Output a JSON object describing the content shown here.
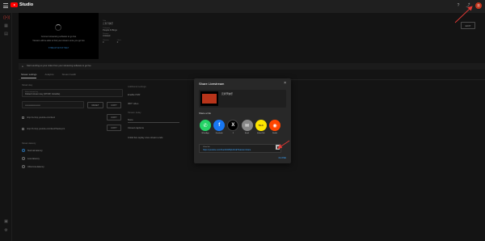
{
  "app": {
    "logo_text": "Studio",
    "avatar_letter": "亦"
  },
  "colors": {
    "accent": "#3ea6ff",
    "brand_red": "#ff0000",
    "annotation": "#e53935",
    "background": "#1f1f1f",
    "dialog_bg": "#282828"
  },
  "preview": {
    "line1": "Connect streaming software to go live",
    "line2": "Viewers will be able to find your stream once you go live",
    "link": "STREAM SETUP HELP"
  },
  "meta": {
    "title_label": "Title",
    "title_value": "元宵节快乐",
    "category_label": "Category",
    "category_value": "People & Blogs",
    "privacy_label": "Privacy",
    "privacy_value": "Unlisted",
    "viewers_label": "Viewers",
    "viewers_value": "0",
    "likes_label": "Likes",
    "likes_value": "0"
  },
  "edit_button": "EDIT",
  "hint": {
    "text": "Start sending us your video from your streaming software to go live"
  },
  "tabs": [
    "Stream settings",
    "Analytics",
    "Stream health"
  ],
  "left": {
    "stream_key_label": "Stream key",
    "select_key_label": "Select stream key",
    "select_key_value": "Default stream key (RTMP, Variable)",
    "stream_key_value": "••••••••••••••••••••",
    "reset": "RESET",
    "copy": "COPY",
    "url1": "rtmp://a.rtmp.youtube.com/live2",
    "url2": "rtmp://b.rtmp.youtube.com/live2?backup=1",
    "latency_label": "Stream latency",
    "latency_options": [
      "Normal latency",
      "Low-latency",
      "Ultra low-latency"
    ]
  },
  "right": {
    "additional": "Additional settings",
    "dvr": "Enable DVR",
    "video360": "360° video",
    "delay": "Stream delay",
    "delay_value": "None",
    "captions": "Closed captions",
    "unlist": "Unlist live replay once stream ends"
  },
  "dialog": {
    "title": "Share Livestream",
    "card_title": "元宵节快乐",
    "share_label": "Share a link",
    "platforms": [
      {
        "name": "WhatsApp",
        "glyph": "✆",
        "color": "#25d366"
      },
      {
        "name": "Facebook",
        "glyph": "f",
        "color": "#1877f2"
      },
      {
        "name": "X",
        "glyph": "X",
        "color": "#000000"
      },
      {
        "name": "Email",
        "glyph": "✉",
        "color": "#888888"
      },
      {
        "name": "KakaoTalk",
        "glyph": "TALK",
        "color": "#fee500"
      },
      {
        "name": "Reddit",
        "glyph": "◉",
        "color": "#ff4500"
      }
    ],
    "link_label": "Video link",
    "link_url": "https://youtube.com/live/4C1Bhj1Z2vE?feature=share",
    "close": "CLOSE"
  }
}
